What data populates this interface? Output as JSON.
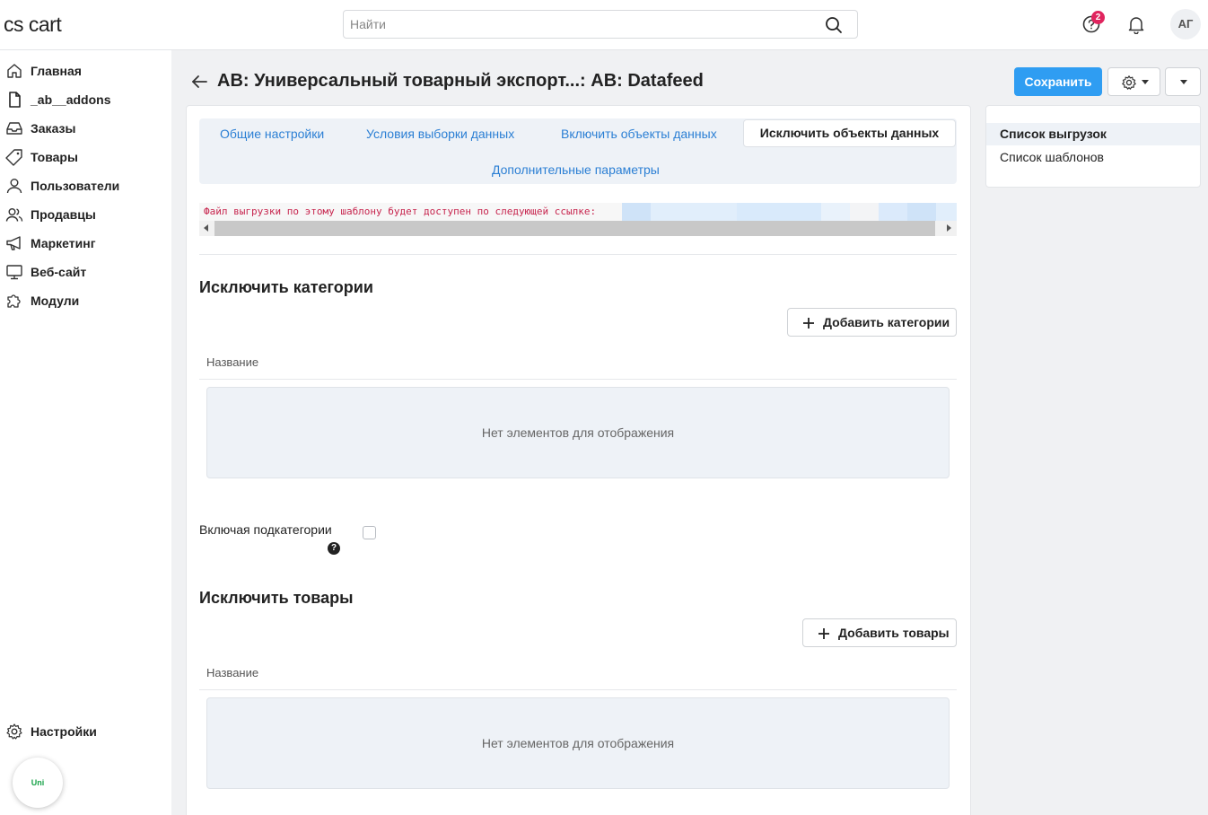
{
  "topbar": {
    "logo": "cs cart",
    "search_placeholder": "Найти",
    "help_badge_count": "2",
    "avatar_initials": "АГ"
  },
  "sidebar": {
    "items": [
      {
        "label": "Главная",
        "icon": "home-icon"
      },
      {
        "label": "_ab__addons",
        "icon": "file-icon"
      },
      {
        "label": "Заказы",
        "icon": "inbox-icon"
      },
      {
        "label": "Товары",
        "icon": "tag-icon"
      },
      {
        "label": "Пользователи",
        "icon": "user-icon"
      },
      {
        "label": "Продавцы",
        "icon": "users-icon"
      },
      {
        "label": "Маркетинг",
        "icon": "megaphone-icon"
      },
      {
        "label": "Веб-сайт",
        "icon": "monitor-icon"
      },
      {
        "label": "Модули",
        "icon": "puzzle-icon"
      }
    ],
    "settings_label": "Настройки",
    "widget_label": "Uni"
  },
  "header": {
    "title": "AB: Универсальный товарный экспорт...: AB: Datafeed",
    "save_label": "Сохранить"
  },
  "tabs": [
    {
      "label": "Общие настройки",
      "active": false
    },
    {
      "label": "Условия выборки данных",
      "active": false
    },
    {
      "label": "Включить объекты данных",
      "active": false
    },
    {
      "label": "Исключить объекты данных",
      "active": true
    },
    {
      "label": "Дополнительные параметры",
      "active": false
    }
  ],
  "link_notice": "Файл выгрузки по этому шаблону будет доступен по следующей ссылке:",
  "exclude_categories": {
    "title": "Исключить категории",
    "add_label": "Добавить категории",
    "column_header": "Название",
    "empty_text": "Нет элементов для отображения",
    "subcategories_label": "Включая подкатегории",
    "subcategories_checked": false
  },
  "exclude_products": {
    "title": "Исключить товары",
    "add_label": "Добавить товары",
    "column_header": "Название",
    "empty_text": "Нет элементов для отображения"
  },
  "right_panel": {
    "items": [
      {
        "label": "Список выгрузок",
        "active": true
      },
      {
        "label": "Список шаблонов",
        "active": false
      }
    ]
  },
  "colors": {
    "primary": "#2f9df2",
    "tab_link": "#2b7fd4",
    "badge": "#e0245e",
    "code_text": "#c7254e"
  }
}
